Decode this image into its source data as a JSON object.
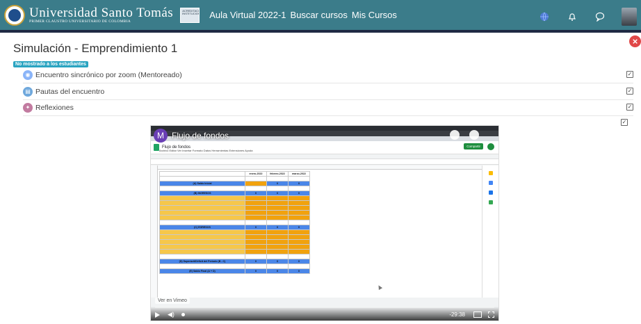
{
  "header": {
    "brand_text": "Universidad Santo Tomás",
    "brand_subtext": "PRIMER CLAUSTRO UNIVERSITARIO DE COLOMBIA",
    "nav": [
      "Aula Virtual 2022-1",
      "Buscar cursos",
      "Mis Cursos"
    ],
    "icons": [
      "globe-icon",
      "bell-icon",
      "chat-icon",
      "user-avatar"
    ]
  },
  "page": {
    "title": "Simulación - Emprendimiento 1",
    "hidden_badge": "No mostrado a los estudiantes"
  },
  "activities": [
    {
      "label": "Encuentro sincrónico por zoom (Mentoreado)",
      "icon": "zoom-icon",
      "color": "#8ab4f8"
    },
    {
      "label": "Pautas del encuentro",
      "icon": "page-icon",
      "color": "#6fa8dc"
    },
    {
      "label": "Reflexiones",
      "icon": "forum-icon",
      "color": "#c27ba0"
    }
  ],
  "video": {
    "channel_initial": "M",
    "title": "Flujo de fondos",
    "time": "-29:38",
    "watermark": "Ver en Vimeo",
    "sheet": {
      "doc_name": "Flujo de fondos",
      "menu": "Archivo  Editar  Ver  Insertar  Formato  Datos  Herramientas  Extensiones  Ayuda",
      "share": "Compartir",
      "columns": [
        "enero-2022",
        "febrero-2022",
        "marzo-2022"
      ],
      "rows": [
        {
          "label": "(A) Saldo Inicial",
          "style": "blue",
          "vals": [
            "",
            "0",
            "0"
          ]
        },
        {
          "label": "(B) INGRESOS",
          "style": "blue",
          "vals": [
            "0",
            "0",
            "0"
          ]
        },
        {
          "label": "(C) EGRESOS",
          "style": "blue",
          "vals": [
            "0",
            "0",
            "0"
          ]
        },
        {
          "label": "(D) Superávit/Déficit del Período (B - C)",
          "style": "blue",
          "vals": [
            "0",
            "0",
            "0"
          ]
        },
        {
          "label": "(E) Saldo Final (A + D)",
          "style": "blue",
          "vals": [
            "0",
            "0",
            "0"
          ]
        }
      ]
    }
  },
  "colors": {
    "topbar": "#3b7c8a",
    "accent_badge": "#2aa4c1",
    "close": "#e04848"
  }
}
